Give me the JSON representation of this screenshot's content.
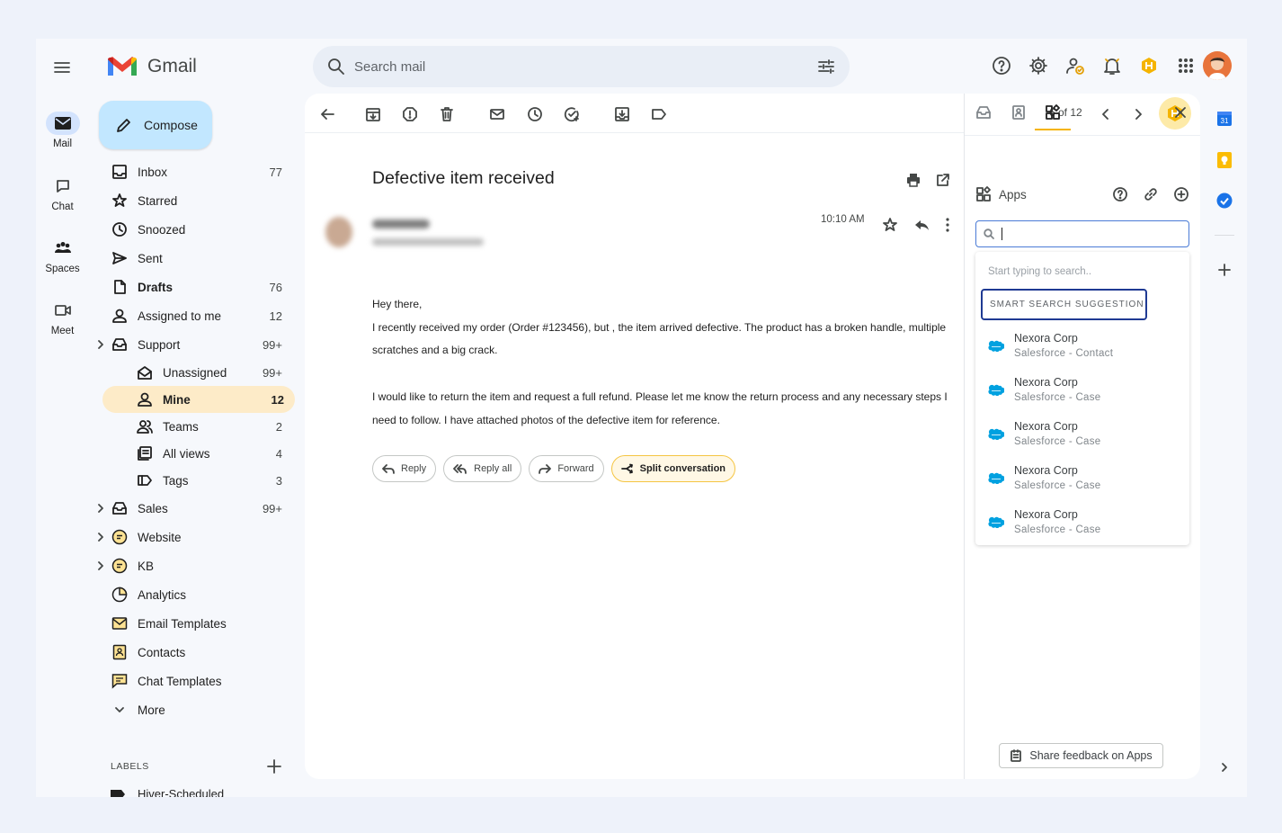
{
  "app": {
    "name": "Gmail"
  },
  "rail": [
    {
      "label": "Mail",
      "icon": "mail-icon",
      "active": true
    },
    {
      "label": "Chat",
      "icon": "chat-icon"
    },
    {
      "label": "Spaces",
      "icon": "spaces-icon"
    },
    {
      "label": "Meet",
      "icon": "meet-icon"
    }
  ],
  "search": {
    "placeholder": "Search mail"
  },
  "compose": {
    "label": "Compose"
  },
  "nav": [
    {
      "label": "Inbox",
      "count": "77",
      "icon": "inbox-icon"
    },
    {
      "label": "Starred",
      "count": "",
      "icon": "star-icon"
    },
    {
      "label": "Snoozed",
      "count": "",
      "icon": "clock-icon"
    },
    {
      "label": "Sent",
      "count": "",
      "icon": "send-icon"
    },
    {
      "label": "Drafts",
      "count": "76",
      "icon": "draft-icon"
    },
    {
      "label": "Assigned to me",
      "count": "12",
      "icon": "person-icon"
    },
    {
      "label": "Support",
      "count": "99+",
      "icon": "shared-inbox-icon"
    },
    {
      "label": "Unassigned",
      "count": "99+",
      "icon": "unassigned-icon"
    },
    {
      "label": "Mine",
      "count": "12",
      "icon": "person-icon",
      "active": true
    },
    {
      "label": "Teams",
      "count": "2",
      "icon": "teams-icon"
    },
    {
      "label": "All views",
      "count": "4",
      "icon": "views-icon"
    },
    {
      "label": "Tags",
      "count": "3",
      "icon": "tag-icon"
    },
    {
      "label": "Sales",
      "count": "99+",
      "icon": "shared-inbox-icon"
    },
    {
      "label": "Website",
      "count": "",
      "icon": "chat-bubble-icon"
    },
    {
      "label": "KB",
      "count": "",
      "icon": "chat-bubble-icon"
    },
    {
      "label": "Analytics",
      "count": "",
      "icon": "analytics-icon"
    },
    {
      "label": "Email Templates",
      "count": "",
      "icon": "email-template-icon"
    },
    {
      "label": "Contacts",
      "count": "",
      "icon": "contacts-icon"
    },
    {
      "label": "Chat Templates",
      "count": "",
      "icon": "chat-template-icon"
    },
    {
      "label": "More",
      "count": "",
      "icon": "chevron-down-icon"
    }
  ],
  "labels": {
    "heading": "LABELS",
    "first": "Hiver-Scheduled"
  },
  "toolbar": {
    "pager": "6 of 12"
  },
  "email": {
    "subject": "Defective item received",
    "time": "10:10 AM",
    "body": [
      "Hey there,",
      "I recently received my order (Order #123456), but , the item arrived defective. The product has a broken handle, multiple scratches and a big crack.",
      "I would like to return the item and request a full refund. Please let me know the return process and any necessary steps I need to follow. I have attached photos of the defective item for reference."
    ],
    "actions": {
      "reply": "Reply",
      "reply_all": "Reply all",
      "forward": "Forward",
      "split": "Split conversation"
    }
  },
  "side_panel": {
    "title": "Apps",
    "search_hint": "Start typing to search..",
    "smart_label": "SMART SEARCH SUGGESTION",
    "results": [
      {
        "title": "Nexora Corp",
        "subtitle": "Salesforce - Contact"
      },
      {
        "title": "Nexora Corp",
        "subtitle": "Salesforce - Case"
      },
      {
        "title": "Nexora Corp",
        "subtitle": "Salesforce - Case"
      },
      {
        "title": "Nexora Corp",
        "subtitle": "Salesforce - Case"
      },
      {
        "title": "Nexora Corp",
        "subtitle": "Salesforce - Case"
      }
    ],
    "feedback": "Share feedback on Apps"
  },
  "colors": {
    "accent": "#0b57d0",
    "compose_bg": "#c2e7ff",
    "active_nav": "#fdebc8",
    "hiver_yellow": "#f5b400",
    "salesforce": "#00a1e0"
  }
}
